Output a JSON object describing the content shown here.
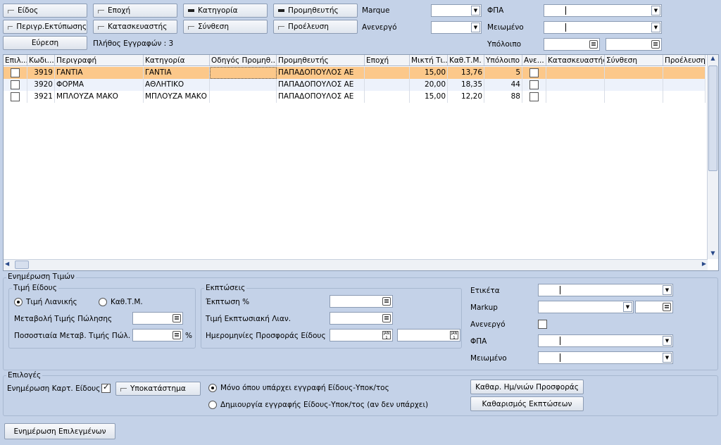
{
  "filters": {
    "row1": [
      "Είδος",
      "Εποχή",
      "Κατηγορία",
      "Προμηθευτής"
    ],
    "row2": [
      "Περιγρ.Εκτύπωσης",
      "Κατασκευαστής",
      "Σύνθεση",
      "Προέλευση"
    ],
    "search_button": "Εύρεση",
    "record_count": "Πλήθος Εγγραφών : 3",
    "marque": "Marque",
    "inactive": "Ανενεργό",
    "vat": "ΦΠΑ",
    "reduced": "Μειωμένο",
    "remaining": "Υπόλοιπο"
  },
  "grid": {
    "columns": [
      "Επιλ...",
      "Κωδι...",
      "Περιγραφή",
      "Κατηγορία",
      "Οδηγός Προμηθ...",
      "Προμηθευτής",
      "Εποχή",
      "Μικτή Τι...",
      "Καθ.Τ.Μ.",
      "Υπόλοιπο",
      "Ανε...",
      "Κατασκευαστής",
      "Σύνθεση",
      "Προέλευση"
    ],
    "rows": [
      {
        "code": "3919",
        "desc": "ΓΑΝΤΙΑ",
        "category": "ΓΑΝΤΙΑ",
        "supplier": "ΠΑΠΑΔΟΠΟΥΛΟΣ ΑΕ",
        "gross": "15,00",
        "net": "13,76",
        "stock": "5"
      },
      {
        "code": "3920",
        "desc": "ΦΟΡΜΑ",
        "category": "ΑΘΛΗΤΙΚΟ",
        "supplier": "ΠΑΠΑΔΟΠΟΥΛΟΣ ΑΕ",
        "gross": "20,00",
        "net": "18,35",
        "stock": "44"
      },
      {
        "code": "3921",
        "desc": "ΜΠΛΟΥΖΑ ΜΑΚΟ",
        "category": "ΜΠΛΟΥΖΑ ΜΑΚΟ",
        "supplier": "ΠΑΠΑΔΟΠΟΥΛΟΣ ΑΕ",
        "gross": "15,00",
        "net": "12,20",
        "stock": "88"
      }
    ]
  },
  "update": {
    "title": "Ενημέρωση Τιμών",
    "item_price": "Τιμή Είδους",
    "retail": "Τιμή Λιανικής",
    "net_cost": "Καθ.Τ.Μ.",
    "price_change": "Μεταβολή Τιμής Πώλησης",
    "pct_change": "Ποσοστιαία Μεταβ. Τιμής Πώλ.",
    "pct": "%",
    "discounts": "Εκπτώσεις",
    "discount_pct": "Έκπτωση %",
    "discount_price": "Τιμή Εκπτωσιακή Λιαν.",
    "offer_dates": "Ημερομηνίες Προσφοράς Είδους",
    "cal": "JAN 1",
    "label": "Ετικέτα",
    "markup": "Markup",
    "inactive": "Ανενεργό",
    "vat": "ΦΠΑ",
    "reduced": "Μειωμένο"
  },
  "options": {
    "title": "Επιλογές",
    "update_card": "Ενημέρωση Καρτ. Είδους",
    "branch": "Υποκατάστημα",
    "only_existing": "Μόνο όπου υπάρχει εγγραφή Είδους-Υποκ/τος",
    "create_record": "Δημιουργία εγγραφής Είδους-Υποκ/τος (αν δεν υπάρχει)",
    "clear_dates": "Καθαρ. Ημ/νιών Προσφοράς",
    "clear_discounts": "Καθαρισμός Εκπτώσεων"
  },
  "update_selected": "Ενημέρωση Επιλεγμένων"
}
